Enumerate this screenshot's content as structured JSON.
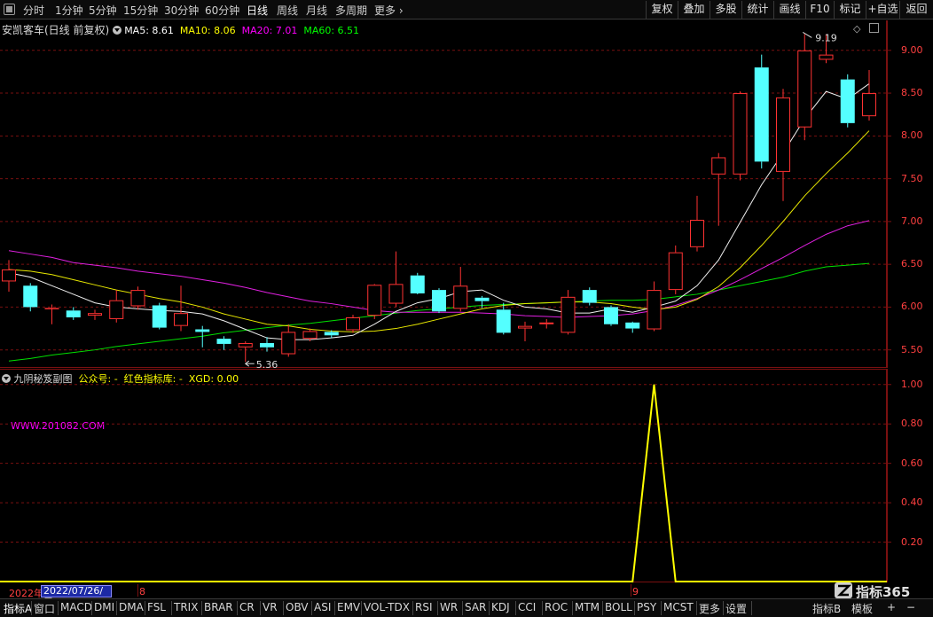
{
  "toolbar": {
    "periods": [
      "分时",
      "1分钟",
      "5分钟",
      "15分钟",
      "30分钟",
      "60分钟",
      "日线",
      "周线",
      "月线",
      "多周期",
      "更多"
    ],
    "active_period": "日线",
    "more_chevron": "›",
    "buttons": [
      "复权",
      "叠加",
      "多股",
      "统计",
      "画线",
      "F10",
      "标记",
      "+自选",
      "返回"
    ]
  },
  "main_panel": {
    "title": "安凯客车(日线 前复权)",
    "ma": [
      {
        "label": "MA5: 8.61",
        "color": "#ffffff"
      },
      {
        "label": "MA10: 8.06",
        "color": "#ffff00"
      },
      {
        "label": "MA20: 7.01",
        "color": "#ff00ff"
      },
      {
        "label": "MA60: 6.51",
        "color": "#00ff00"
      }
    ],
    "high_marker": "9.19",
    "low_marker": "5.36",
    "y_ticks": [
      "9.00",
      "8.50",
      "8.00",
      "7.50",
      "7.00",
      "6.50",
      "6.00",
      "5.50"
    ]
  },
  "sub_panel": {
    "title": "九阴秘笈副图",
    "public_label": "公众号: -",
    "indicator_label": "红色指标库: -",
    "xgd_label": "XGD: 0.00",
    "watermark": "WWW.201082.COM",
    "y_ticks": [
      "1.00",
      "0.80",
      "0.60",
      "0.40",
      "0.20"
    ]
  },
  "x_axis": {
    "year_label": "2022年",
    "date_cursor": "2022/07/26/二",
    "month_labels": [
      "8",
      "9"
    ]
  },
  "brand": "指标365",
  "bottom_tabs": [
    "指标A",
    "窗口",
    "MACD",
    "DMI",
    "DMA",
    "FSL",
    "TRIX",
    "BRAR",
    "CR",
    "VR",
    "OBV",
    "ASI",
    "EMV",
    "VOL-TDX",
    "RSI",
    "WR",
    "SAR",
    "KDJ",
    "CCI",
    "ROC",
    "MTM",
    "BOLL",
    "PSY",
    "MCST",
    "更多",
    "设置"
  ],
  "bottom_right_tabs": [
    "指标B",
    "模板",
    "+",
    "−"
  ],
  "colors": {
    "up": "#ff3232",
    "down": "#54ffff",
    "grid": "#7a1010",
    "axis_text": "#ff4040",
    "signal": "#ffff00"
  },
  "chart_data": {
    "type": "candlestick",
    "ylim": [
      5.3,
      9.35
    ],
    "candles": [
      [
        6.3,
        6.44,
        6.55,
        6.18
      ],
      [
        6.25,
        6.0,
        6.28,
        5.95
      ],
      [
        5.98,
        5.99,
        6.03,
        5.8
      ],
      [
        5.96,
        5.88,
        6.0,
        5.85
      ],
      [
        5.9,
        5.93,
        5.97,
        5.85
      ],
      [
        5.86,
        6.08,
        6.2,
        5.82
      ],
      [
        6.01,
        6.2,
        6.24,
        5.97
      ],
      [
        6.02,
        5.76,
        6.05,
        5.74
      ],
      [
        5.78,
        5.93,
        6.25,
        5.72
      ],
      [
        5.74,
        5.71,
        5.78,
        5.53
      ],
      [
        5.63,
        5.57,
        5.66,
        5.5
      ],
      [
        5.53,
        5.58,
        5.6,
        5.36
      ],
      [
        5.58,
        5.53,
        5.65,
        5.48
      ],
      [
        5.45,
        5.71,
        5.8,
        5.42
      ],
      [
        5.63,
        5.72,
        5.75,
        5.6
      ],
      [
        5.71,
        5.67,
        5.73,
        5.64
      ],
      [
        5.73,
        5.88,
        5.91,
        5.7
      ],
      [
        5.9,
        6.26,
        6.27,
        5.86
      ],
      [
        6.04,
        6.27,
        6.65,
        6.0
      ],
      [
        6.37,
        6.16,
        6.4,
        6.15
      ],
      [
        6.2,
        5.95,
        6.22,
        5.93
      ],
      [
        5.98,
        6.25,
        6.47,
        5.95
      ],
      [
        6.11,
        6.07,
        6.13,
        5.99
      ],
      [
        5.97,
        5.7,
        6.05,
        5.68
      ],
      [
        5.75,
        5.78,
        5.83,
        5.6
      ],
      [
        5.8,
        5.82,
        5.86,
        5.75
      ],
      [
        5.7,
        6.12,
        6.2,
        5.68
      ],
      [
        6.2,
        6.05,
        6.23,
        6.02
      ],
      [
        6.0,
        5.8,
        6.02,
        5.78
      ],
      [
        5.82,
        5.75,
        5.83,
        5.7
      ],
      [
        5.74,
        6.2,
        6.3,
        5.72
      ],
      [
        6.2,
        6.64,
        6.72,
        6.15
      ],
      [
        6.7,
        7.02,
        7.3,
        6.65
      ],
      [
        7.55,
        7.75,
        7.8,
        6.95
      ],
      [
        7.55,
        8.5,
        8.52,
        7.48
      ],
      [
        8.8,
        7.7,
        8.95,
        7.62
      ],
      [
        7.58,
        8.45,
        8.55,
        7.24
      ],
      [
        8.1,
        9.0,
        9.19,
        7.95
      ],
      [
        8.89,
        8.95,
        9.19,
        8.85
      ],
      [
        8.66,
        8.15,
        8.72,
        8.1
      ],
      [
        8.23,
        8.5,
        8.77,
        8.18
      ]
    ],
    "ma5": [
      6.4,
      6.35,
      6.25,
      6.15,
      6.05,
      6.0,
      5.98,
      5.96,
      5.95,
      5.92,
      5.84,
      5.74,
      5.64,
      5.62,
      5.62,
      5.64,
      5.67,
      5.8,
      5.95,
      6.05,
      6.1,
      6.18,
      6.2,
      6.08,
      6.0,
      5.98,
      5.93,
      5.93,
      5.98,
      5.94,
      6.0,
      6.07,
      6.25,
      6.55,
      6.99,
      7.43,
      7.8,
      8.2,
      8.52,
      8.43,
      8.61
    ],
    "ma10": [
      6.44,
      6.42,
      6.38,
      6.32,
      6.26,
      6.2,
      6.15,
      6.1,
      6.06,
      6.0,
      5.92,
      5.86,
      5.8,
      5.78,
      5.74,
      5.72,
      5.71,
      5.72,
      5.75,
      5.8,
      5.86,
      5.92,
      5.98,
      6.02,
      6.04,
      6.05,
      6.06,
      6.06,
      6.04,
      6.0,
      5.97,
      6.0,
      6.09,
      6.24,
      6.46,
      6.72,
      7.0,
      7.3,
      7.56,
      7.8,
      8.06
    ],
    "ma20": [
      6.66,
      6.62,
      6.58,
      6.52,
      6.49,
      6.46,
      6.42,
      6.39,
      6.36,
      6.32,
      6.28,
      6.23,
      6.17,
      6.12,
      6.07,
      6.04,
      6.0,
      5.96,
      5.94,
      5.94,
      5.94,
      5.94,
      5.93,
      5.92,
      5.9,
      5.89,
      5.88,
      5.89,
      5.9,
      5.92,
      5.96,
      6.02,
      6.1,
      6.2,
      6.32,
      6.45,
      6.58,
      6.72,
      6.85,
      6.95,
      7.01
    ],
    "ma60": [
      5.37,
      5.4,
      5.44,
      5.47,
      5.5,
      5.54,
      5.57,
      5.6,
      5.63,
      5.66,
      5.7,
      5.73,
      5.76,
      5.79,
      5.81,
      5.84,
      5.87,
      5.9,
      5.93,
      5.96,
      5.98,
      6.0,
      6.02,
      6.03,
      6.04,
      6.05,
      6.06,
      6.07,
      6.08,
      6.08,
      6.09,
      6.12,
      6.15,
      6.2,
      6.25,
      6.3,
      6.35,
      6.42,
      6.47,
      6.49,
      6.51
    ],
    "signal": {
      "ylim": [
        0,
        1.08
      ],
      "spike_index": 30,
      "spike_value": 1.0
    }
  }
}
